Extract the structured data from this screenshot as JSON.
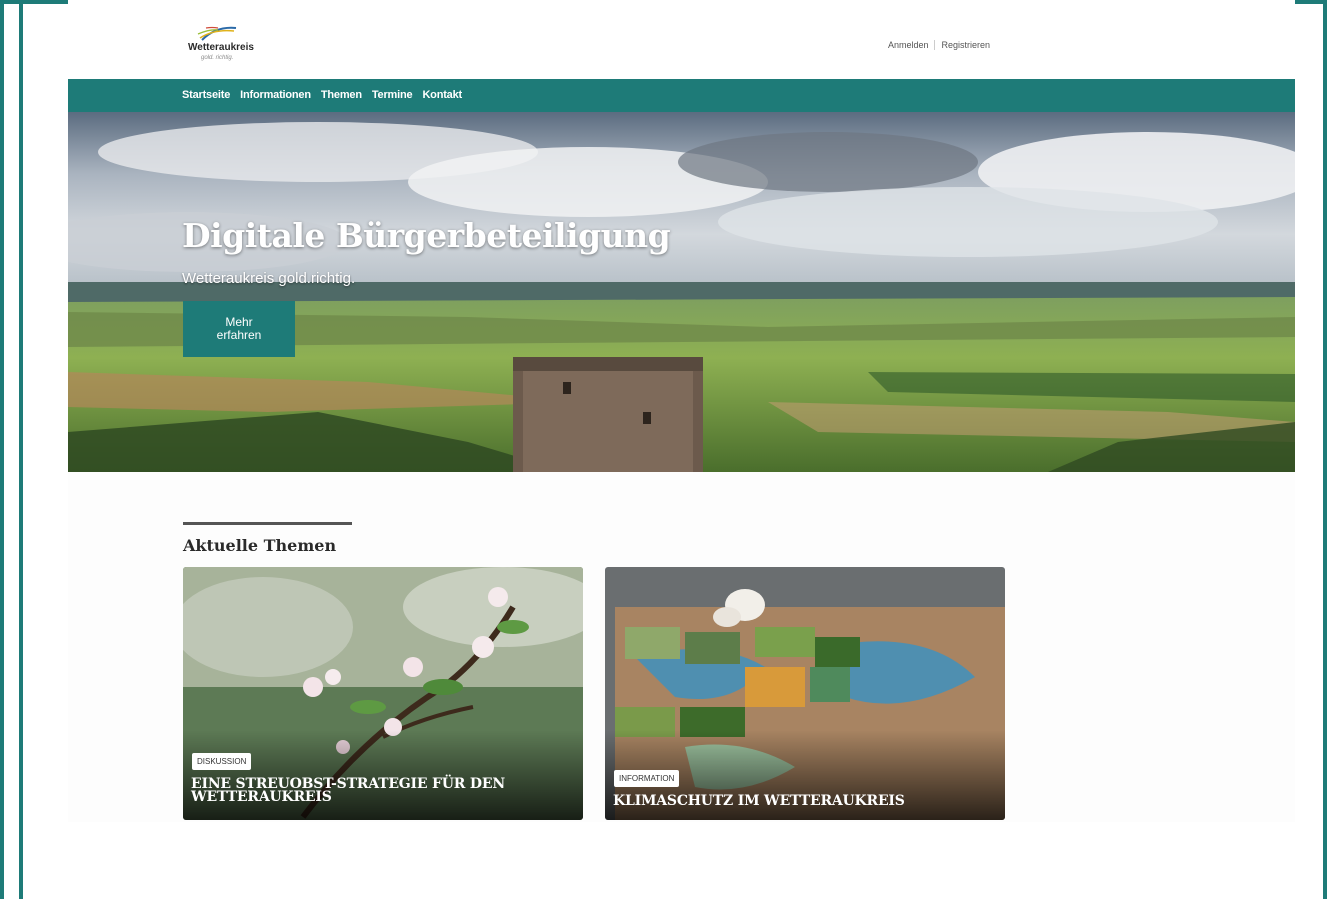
{
  "header": {
    "logo_text": "Wetteraukreis",
    "logo_tagline": "gold. richtig.",
    "login_label": "Anmelden",
    "register_label": "Registrieren"
  },
  "nav": {
    "items": [
      {
        "label": "Startseite"
      },
      {
        "label": "Informationen"
      },
      {
        "label": "Themen"
      },
      {
        "label": "Termine"
      },
      {
        "label": "Kontakt"
      }
    ]
  },
  "hero": {
    "title": "Digitale Bürgerbeteiligung",
    "subtitle": "Wetteraukreis gold.richtig.",
    "button_label": "Mehr erfahren"
  },
  "topics": {
    "heading": "Aktuelle Themen",
    "cards": [
      {
        "badge": "Diskussion",
        "title": "Eine Streuobst-Strategie für den Wetteraukreis"
      },
      {
        "badge": "Information",
        "title": "Klimaschutz im Wetteraukreis"
      }
    ]
  },
  "colors": {
    "brand_teal": "#1e7b78"
  }
}
